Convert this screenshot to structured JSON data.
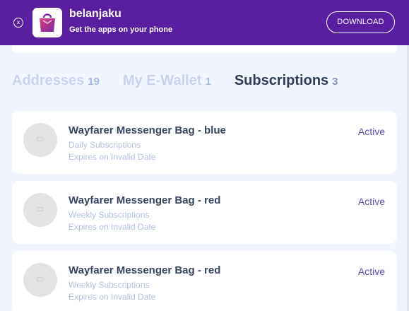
{
  "banner": {
    "close_symbol": "x",
    "app_name": "belanjaku",
    "tagline": "Get the apps on your phone",
    "download_label": "DOWNLOAD",
    "background_color": "#5a1fa0",
    "logo_icon": "shopping-bag-icon"
  },
  "tabs": [
    {
      "label": "Addresses",
      "count": "19",
      "active": false
    },
    {
      "label": "My E-Wallet",
      "count": "1",
      "active": false
    },
    {
      "label": "Subscriptions",
      "count": "3",
      "active": true
    }
  ],
  "subscriptions": [
    {
      "title": "Wayfarer Messenger Bag - blue",
      "frequency": "Daily Subscriptions",
      "expires": "Expires on Invalid Date",
      "status": "Active"
    },
    {
      "title": "Wayfarer Messenger Bag - red",
      "frequency": "Weekly Subscriptions",
      "expires": "Expires on Invalid Date",
      "status": "Active"
    },
    {
      "title": "Wayfarer Messenger Bag - red",
      "frequency": "Weekly Subscriptions",
      "expires": "Expires on Invalid Date",
      "status": "Active"
    }
  ]
}
